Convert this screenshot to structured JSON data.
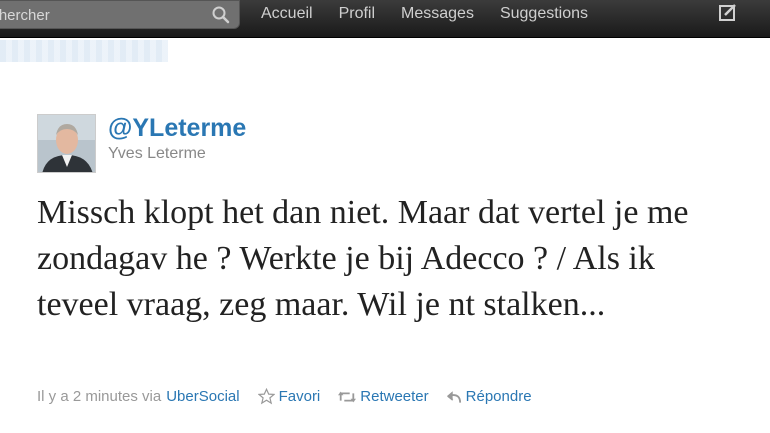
{
  "topbar": {
    "search_placeholder": "echercher",
    "nav": [
      "Accueil",
      "Profil",
      "Messages",
      "Suggestions"
    ]
  },
  "tweet": {
    "handle": "@YLeterme",
    "name": "Yves Leterme",
    "text": "Missch klopt het dan niet. Maar dat vertel je me zondagav he ? Werkte je bij Adecco ? / Als ik teveel vraag, zeg maar. Wil je nt stalken...",
    "time": "Il y a 2 minutes via",
    "source": "UberSocial",
    "actions": {
      "favorite": "Favori",
      "retweet": "Retweeter",
      "reply": "Répondre"
    }
  },
  "colors": {
    "link": "#2a77b3",
    "topbar": "#222222"
  }
}
